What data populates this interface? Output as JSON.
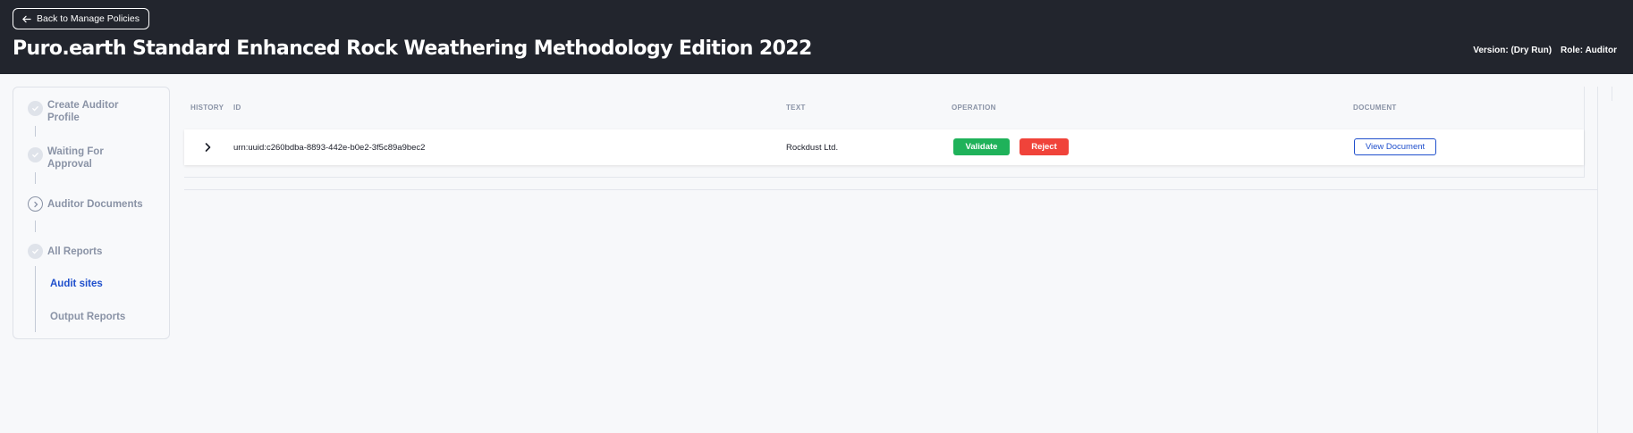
{
  "header": {
    "back_label": "Back to Manage Policies",
    "title": "Puro.earth Standard Enhanced Rock Weathering Methodology Edition 2022",
    "version": "Version: (Dry Run)",
    "role": "Role: Auditor",
    "background": "#22252d"
  },
  "steps": {
    "items": [
      {
        "label": "Create Auditor Profile",
        "state": "done"
      },
      {
        "label": "Waiting For Approval",
        "state": "done"
      },
      {
        "label": "Auditor Documents",
        "state": "current"
      },
      {
        "label": "All Reports",
        "state": "done"
      }
    ],
    "sub_items": [
      {
        "label": "Audit sites",
        "active": true
      },
      {
        "label": "Output Reports",
        "active": false
      }
    ]
  },
  "table": {
    "headers": {
      "history": "HISTORY",
      "id": "ID",
      "text": "TEXT",
      "operation": "OPERATION",
      "document": "DOCUMENT"
    },
    "rows": [
      {
        "id": "urn:uuid:c260bdba-8893-442e-b0e2-3f5c89a9bec2",
        "text": "Rockdust Ltd.",
        "validate_label": "Validate",
        "reject_label": "Reject",
        "document_label": "View Document"
      }
    ]
  },
  "colors": {
    "accent": "#1f4fcc",
    "validate": "#1fb25a",
    "reject": "#f0433a"
  }
}
